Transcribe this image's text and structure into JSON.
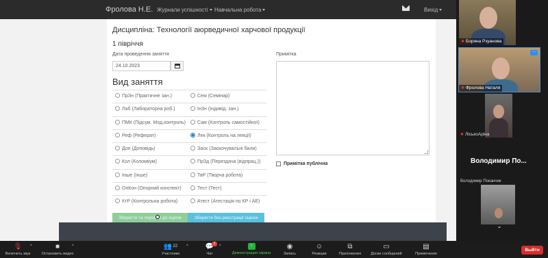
{
  "navbar": {
    "user": "Фролова Н.Е.",
    "journals": "Журнали успішності",
    "teaching": "Навчальна робота",
    "logout": "Вихід"
  },
  "form": {
    "discipline": "Дисципліна: Технології аюрведичної харчової продукції",
    "semester": "1 півріччя",
    "date_label": "Дата проведення заняття",
    "date_value": "24.10.2023",
    "type_title": "Вид заняття",
    "lesson_types": [
      [
        "ПрЗн (Практичне зан.)",
        "Сем (Семінар)"
      ],
      [
        "Лаб (Лабораторна роб.)",
        "ІнЗн (Індивід. зан.)"
      ],
      [
        "ПМК (Підсум. Мод.контроль)",
        "Сам (Контроль самостійної)"
      ],
      [
        "Реф (Реферат)",
        "Лек (Контроль на лекції)"
      ],
      [
        "Доп (Доповідь)",
        "Заох (Заохочувальні бали)"
      ],
      [
        "Кол (Колоквіум)",
        "ПрЗд (Перездача (відпрац.))"
      ],
      [
        "Інше (Інше)",
        "ТвР (Творча робота)"
      ],
      [
        "ОпКон (Опорний конспект)",
        "Тест (Тест)"
      ],
      [
        "КтР (Контрольна робота)",
        "Атест (Атестація по КР і АЕ)"
      ]
    ],
    "selected_type": "Лек (Контроль на лекції)",
    "note_label": "Примітка",
    "public_label": "Примітка публічна",
    "btn_save_go": "Зберегти та перейти до оцінок",
    "btn_save": "Зберегти без реєстрації оцінок"
  },
  "participants": {
    "p1": "Боряна Рзуанова",
    "p2": "Фролова Наталя",
    "p3": "ЛіськоАріна",
    "big_name": "Володимир По...",
    "p4_small": "Володимир Поканчик"
  },
  "toolbar": {
    "mute": "Включить звук",
    "video": "Остановить видео",
    "participants": "Участники",
    "participants_count": "22",
    "chat": "Чат",
    "chat_badge": "1",
    "share": "Демонстрация экрана",
    "record": "Запись",
    "reactions": "Реакции",
    "apps": "Приложения",
    "whiteboards": "Доски сообщений",
    "notes": "Примечания",
    "leave": "Выйти"
  },
  "colors": {
    "accent_green": "#23b33a",
    "leave_red": "#d92b2b",
    "save_go": "#8fce9a",
    "save": "#5bc0de"
  }
}
